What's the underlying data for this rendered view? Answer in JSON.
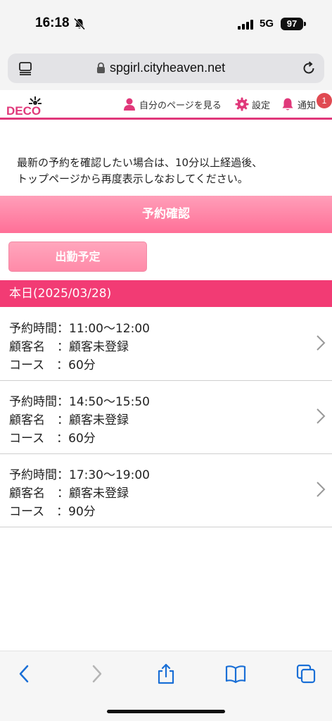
{
  "status_bar": {
    "time": "16:18",
    "network": "5G",
    "battery": "97"
  },
  "browser": {
    "url": "spgirl.cityheaven.net"
  },
  "header": {
    "logo_text": "DECO",
    "mypage_label": "自分のページを見る",
    "settings_label": "設定",
    "notice_label": "通知",
    "notice_count": "1",
    "accent_color": "#e0387a"
  },
  "main": {
    "notice_line1": "最新の予約を確認したい場合は、10分以上経過後、",
    "notice_line2": "トップページから再度表示しなおしてください。",
    "section_title": "予約確認",
    "shift_button_label": "出勤予定",
    "date_label": "本日(2025/03/28)",
    "reservations": [
      {
        "time": "予約時間：11:00〜12:00",
        "customer": "顧客名　：顧客未登録",
        "course": "コース　：60分"
      },
      {
        "time": "予約時間：14:50〜15:50",
        "customer": "顧客名　：顧客未登録",
        "course": "コース　：60分"
      },
      {
        "time": "予約時間：17:30〜19:00",
        "customer": "顧客名　：顧客未登録",
        "course": "コース　：90分"
      }
    ]
  }
}
